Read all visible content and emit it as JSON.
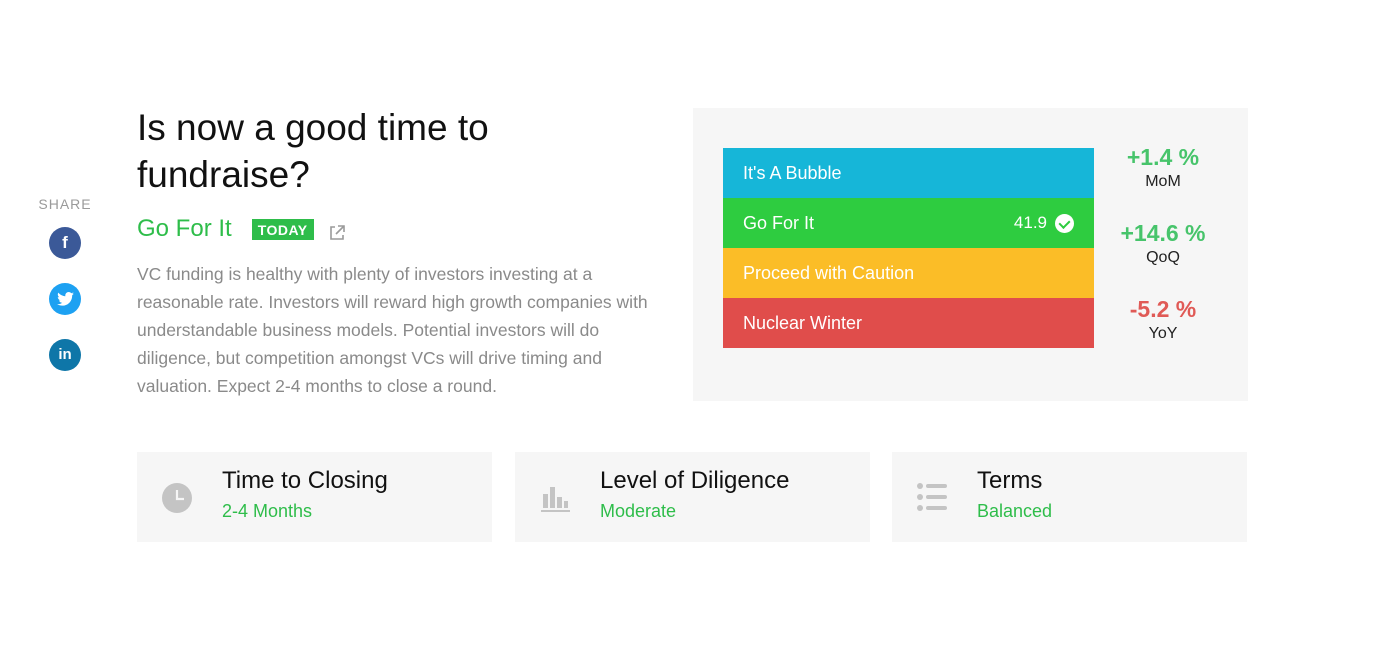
{
  "share": {
    "label": "SHARE",
    "facebook": "f",
    "twitter": "t",
    "linkedin": "in"
  },
  "header": {
    "title": "Is now a good time to fundraise?",
    "status": "Go For It",
    "badge": "TODAY",
    "status_color": "#2ebd4a"
  },
  "description": "VC funding is healthy with plenty of investors investing at a reasonable rate. Investors will reward high growth companies with understandable business models. Potential investors will do diligence, but competition amongst VCs will drive timing and valuation. Expect 2-4 months to close a round.",
  "scale": {
    "rows": [
      {
        "label": "It's A Bubble",
        "color": "#16b6d8",
        "value": ""
      },
      {
        "label": "Go For It",
        "color": "#2ecc40",
        "value": "41.9",
        "selected": true
      },
      {
        "label": "Proceed with Caution",
        "color": "#fbbd27",
        "value": ""
      },
      {
        "label": "Nuclear Winter",
        "color": "#e04d4b",
        "value": ""
      }
    ]
  },
  "changes": [
    {
      "value": "+1.4 %",
      "label": "MoM",
      "color": "#47c46b"
    },
    {
      "value": "+14.6 %",
      "label": "QoQ",
      "color": "#47c46b"
    },
    {
      "value": "-5.2 %",
      "label": "YoY",
      "color": "#e05a56"
    }
  ],
  "cards": [
    {
      "title": "Time to Closing",
      "value": "2-4 Months",
      "icon": "clock-icon"
    },
    {
      "title": "Level of Diligence",
      "value": "Moderate",
      "icon": "bar-chart-icon"
    },
    {
      "title": "Terms",
      "value": "Balanced",
      "icon": "list-icon"
    }
  ]
}
